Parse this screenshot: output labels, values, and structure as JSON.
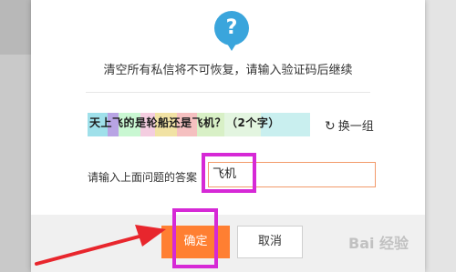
{
  "dialog": {
    "message": "清空所有私信将不可恢复，请输入验证码后继续",
    "help_icon": "question-icon"
  },
  "captcha": {
    "text": "天上飞的是轮船还是飞机？（2个字）"
  },
  "refresh": {
    "icon": "refresh-icon",
    "label": "换一组"
  },
  "answer": {
    "label": "请输入上面问题的答案",
    "value": "飞机"
  },
  "buttons": {
    "confirm": "确定",
    "cancel": "取消"
  },
  "watermark": {
    "text": "Bai 经验"
  },
  "colors": {
    "accent": "#ff7f32",
    "highlight": "#d629d6",
    "help_icon": "#3aa5dc",
    "arrow": "#e8262d"
  }
}
